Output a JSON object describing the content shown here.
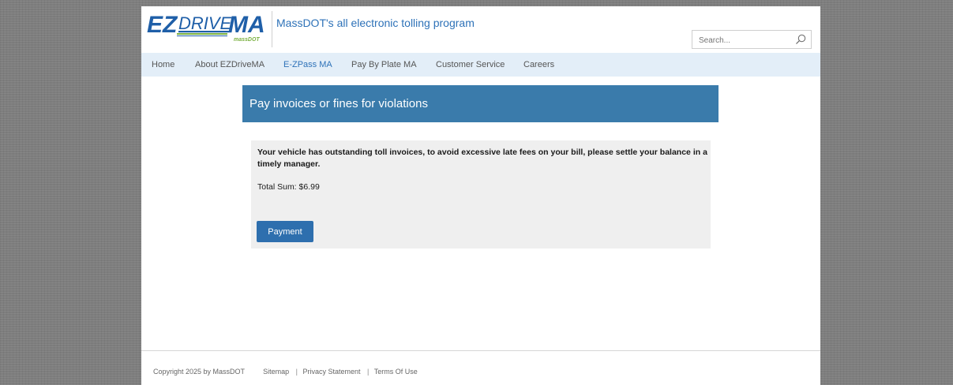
{
  "header": {
    "logo_text": "EZDRIVEMA",
    "logo_sub": "massDOT",
    "tagline": "MassDOT's all electronic tolling program",
    "search_placeholder": "Search..."
  },
  "nav": {
    "items": [
      {
        "label": "Home"
      },
      {
        "label": "About EZDriveMA"
      },
      {
        "label": "E-ZPass MA"
      },
      {
        "label": "Pay By Plate MA"
      },
      {
        "label": "Customer Service"
      },
      {
        "label": "Careers"
      }
    ],
    "active_index": 2
  },
  "banner": {
    "title": "Pay invoices or fines for violations"
  },
  "panel": {
    "notice": "Your vehicle has outstanding toll invoices, to avoid excessive late fees on your bill, please settle your balance in a timely manager.",
    "total": "Total Sum: $6.99",
    "payment_button": "Payment"
  },
  "footer": {
    "copyright": "Copyright 2025 by MassDOT",
    "links": [
      "Sitemap",
      "Privacy Statement",
      "Terms Of Use"
    ],
    "separator": "|"
  },
  "colors": {
    "brand_blue": "#2e72b8",
    "banner_blue": "#3a7bab",
    "nav_bg": "#e3eef8",
    "logo_green": "#7ab040"
  }
}
